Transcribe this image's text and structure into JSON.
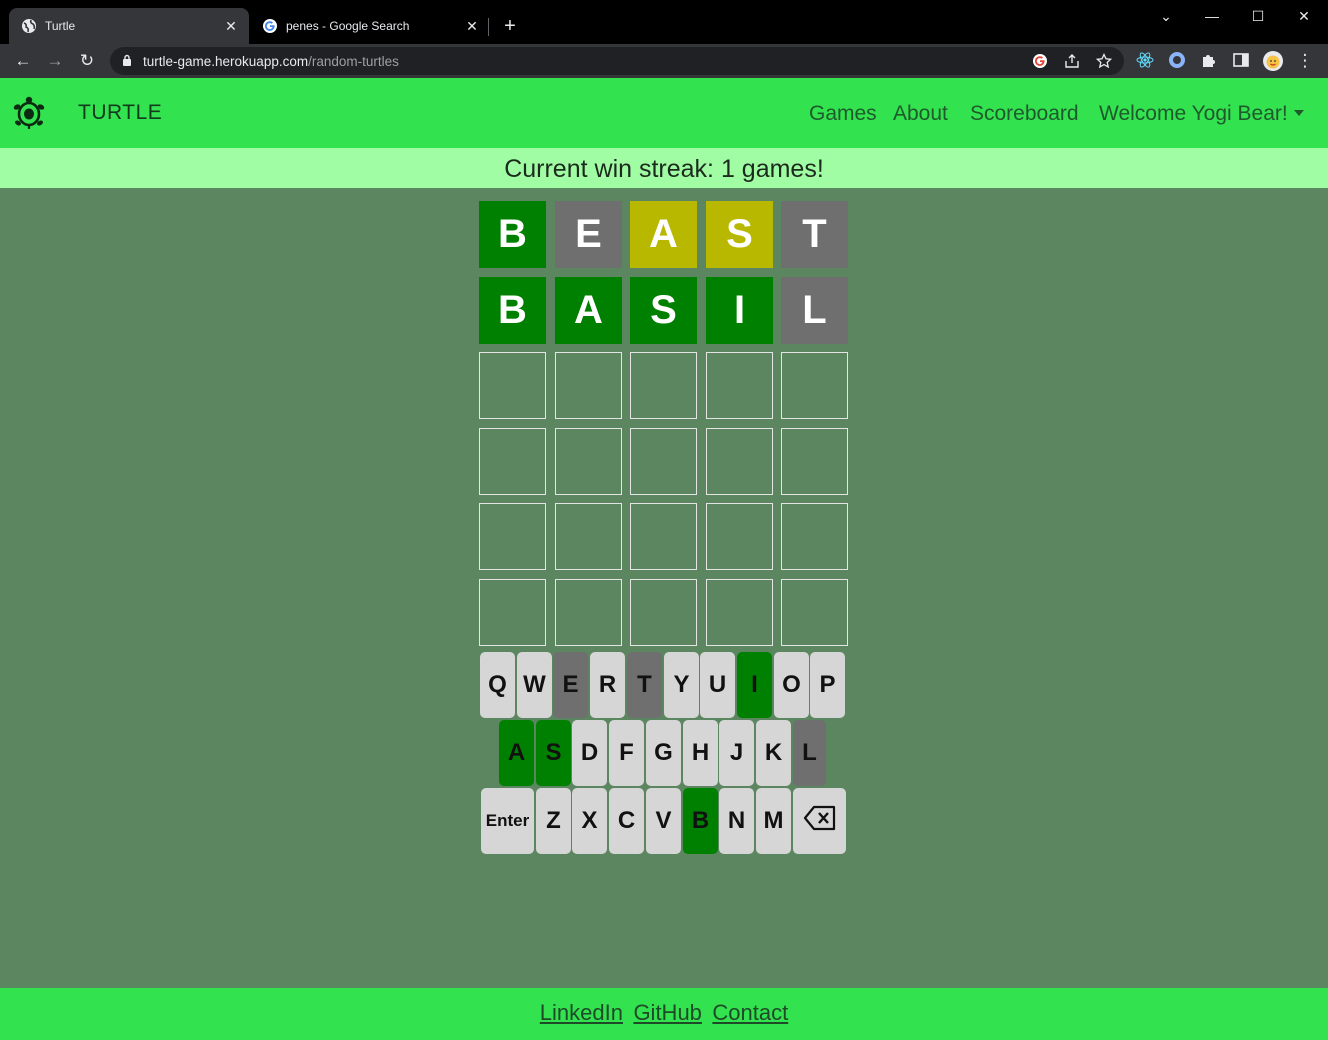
{
  "browser": {
    "tabs": [
      {
        "title": "Turtle",
        "active": true,
        "icon": "globe-icon"
      },
      {
        "title": "penes - Google Search",
        "active": false,
        "icon": "google-icon"
      }
    ],
    "url_host": "turtle-game.herokuapp.com",
    "url_path": "/random-turtles"
  },
  "navbar": {
    "brand": "TURTLE",
    "links": [
      "Games",
      "About",
      "Scoreboard"
    ],
    "user_menu": "Welcome Yogi Bear!"
  },
  "streak_text": "Current win streak: 1 games!",
  "board": {
    "rows": [
      [
        {
          "l": "B",
          "s": "green"
        },
        {
          "l": "E",
          "s": "gray"
        },
        {
          "l": "A",
          "s": "yellow"
        },
        {
          "l": "S",
          "s": "yellow"
        },
        {
          "l": "T",
          "s": "gray"
        }
      ],
      [
        {
          "l": "B",
          "s": "green"
        },
        {
          "l": "A",
          "s": "green"
        },
        {
          "l": "S",
          "s": "green"
        },
        {
          "l": "I",
          "s": "green"
        },
        {
          "l": "L",
          "s": "gray"
        }
      ],
      [
        {
          "l": "",
          "s": "empty"
        },
        {
          "l": "",
          "s": "empty"
        },
        {
          "l": "",
          "s": "empty"
        },
        {
          "l": "",
          "s": "empty"
        },
        {
          "l": "",
          "s": "empty"
        }
      ],
      [
        {
          "l": "",
          "s": "empty"
        },
        {
          "l": "",
          "s": "empty"
        },
        {
          "l": "",
          "s": "empty"
        },
        {
          "l": "",
          "s": "empty"
        },
        {
          "l": "",
          "s": "empty"
        }
      ],
      [
        {
          "l": "",
          "s": "empty"
        },
        {
          "l": "",
          "s": "empty"
        },
        {
          "l": "",
          "s": "empty"
        },
        {
          "l": "",
          "s": "empty"
        },
        {
          "l": "",
          "s": "empty"
        }
      ],
      [
        {
          "l": "",
          "s": "empty"
        },
        {
          "l": "",
          "s": "empty"
        },
        {
          "l": "",
          "s": "empty"
        },
        {
          "l": "",
          "s": "empty"
        },
        {
          "l": "",
          "s": "empty"
        }
      ]
    ]
  },
  "keyboard": {
    "rows": [
      [
        {
          "k": "Q",
          "s": "none"
        },
        {
          "k": "W",
          "s": "none"
        },
        {
          "k": "E",
          "s": "gray"
        },
        {
          "k": "R",
          "s": "none"
        },
        {
          "k": "T",
          "s": "gray"
        },
        {
          "k": "Y",
          "s": "none"
        },
        {
          "k": "U",
          "s": "none"
        },
        {
          "k": "I",
          "s": "green"
        },
        {
          "k": "O",
          "s": "none"
        },
        {
          "k": "P",
          "s": "none"
        }
      ],
      [
        {
          "k": "A",
          "s": "green"
        },
        {
          "k": "S",
          "s": "green"
        },
        {
          "k": "D",
          "s": "none"
        },
        {
          "k": "F",
          "s": "none"
        },
        {
          "k": "G",
          "s": "none"
        },
        {
          "k": "H",
          "s": "none"
        },
        {
          "k": "J",
          "s": "none"
        },
        {
          "k": "K",
          "s": "none"
        },
        {
          "k": "L",
          "s": "gray"
        }
      ],
      [
        {
          "k": "Enter",
          "s": "none"
        },
        {
          "k": "Z",
          "s": "none"
        },
        {
          "k": "X",
          "s": "none"
        },
        {
          "k": "C",
          "s": "none"
        },
        {
          "k": "V",
          "s": "none"
        },
        {
          "k": "B",
          "s": "green"
        },
        {
          "k": "N",
          "s": "none"
        },
        {
          "k": "M",
          "s": "none"
        },
        {
          "k": "",
          "s": "none",
          "icon": "backspace-icon"
        }
      ]
    ]
  },
  "footer": {
    "links": [
      "LinkedIn",
      "GitHub",
      "Contact"
    ]
  },
  "colors": {
    "navbar": "#32e24f",
    "streak_bar": "#a1fda4",
    "page_bg": "#5b8660",
    "correct": "#008000",
    "present": "#b8b800",
    "absent": "#6f6f6f",
    "key_default": "#d6d6d6"
  }
}
